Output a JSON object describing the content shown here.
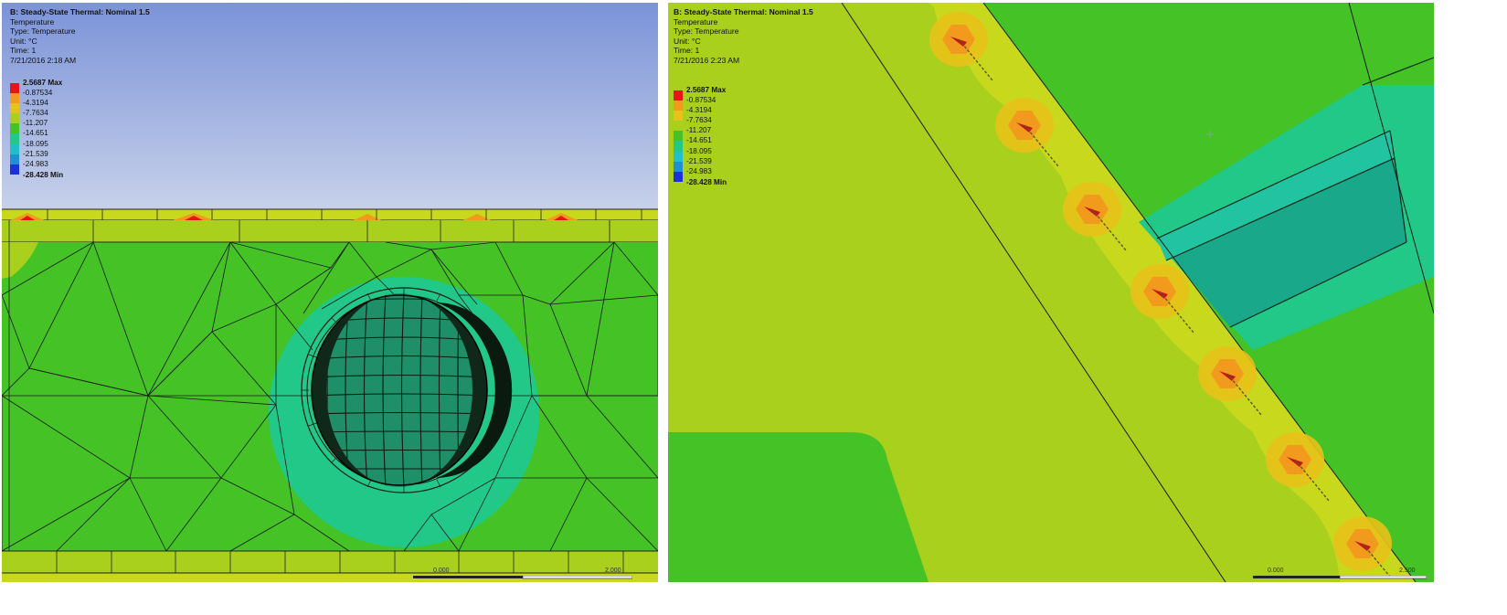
{
  "left_view": {
    "title": "B: Steady-State Thermal: Nominal 1.5",
    "result": "Temperature",
    "type": "Type: Temperature",
    "unit": "Unit: °C",
    "time": "Time: 1",
    "date": "7/21/2016 2:18 AM",
    "scale": {
      "start": "0.000",
      "end": "2.000"
    }
  },
  "right_view": {
    "title": "B: Steady-State Thermal: Nominal 1.5",
    "result": "Temperature",
    "type": "Type: Temperature",
    "unit": "Unit: °C",
    "time": "Time: 1",
    "date": "7/21/2016 2:23 AM",
    "scale": {
      "start": "0.000",
      "end": "2.500"
    }
  },
  "legend": {
    "max_label": "2.5687 Max",
    "min_label": "-28.428 Min",
    "levels": [
      "-0.87534",
      "-4.3194",
      "-7.7634",
      "-11.207",
      "-14.651",
      "-18.095",
      "-21.539",
      "-24.983"
    ],
    "colors": [
      "#e8141a",
      "#f29a1e",
      "#e8c21a",
      "#a8d01c",
      "#44c226",
      "#22c888",
      "#22bfc8",
      "#1f8fd6",
      "#1b33d6"
    ]
  }
}
